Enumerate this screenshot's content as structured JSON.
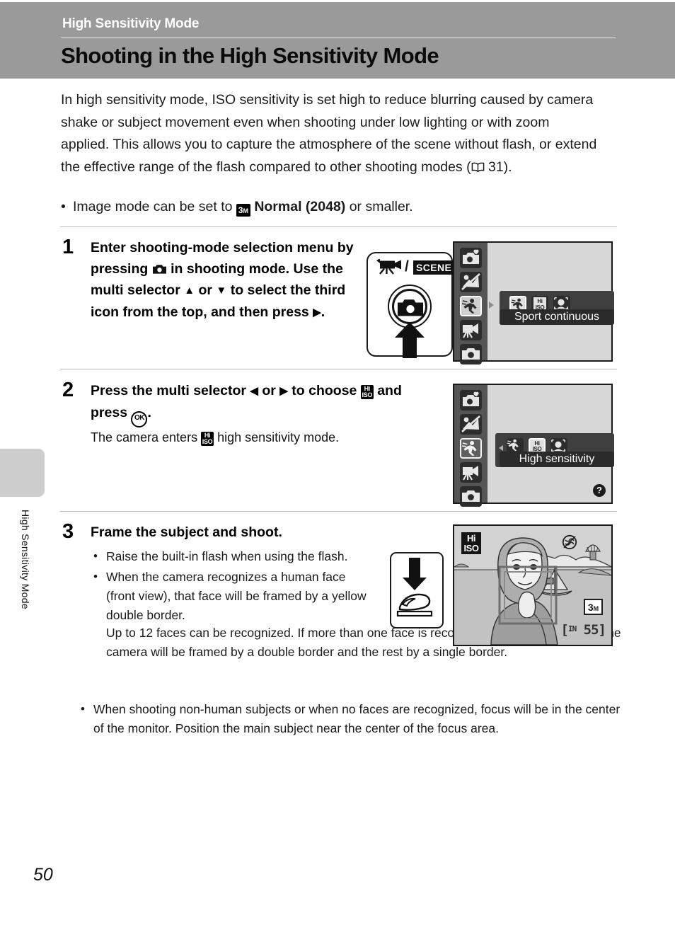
{
  "header": {
    "section_label": "High Sensitivity Mode",
    "title": "Shooting in the High Sensitivity Mode"
  },
  "side_tab": {
    "label": "High Sensitivity Mode"
  },
  "intro": {
    "paragraph_part1": "In high sensitivity mode, ISO sensitivity is set high to reduce blurring caused by camera shake or subject movement even when shooting under low lighting or with zoom applied. This allows you to capture the atmosphere of the scene without flash, or extend the effective range of the flash compared to other shooting modes (",
    "paragraph_part2": " 31).",
    "bullet_part1": "Image mode can be set to ",
    "bullet_bold": "Normal (2048)",
    "bullet_part2": " or smaller."
  },
  "steps": [
    {
      "number": "1",
      "text_part1": "Enter shooting-mode selection menu by pressing ",
      "text_part2": " in shooting mode. Use the multi selector ",
      "text_part3": " or ",
      "text_part4": " to select the third icon from the top, and then press ",
      "text_part5": "."
    },
    {
      "number": "2",
      "text_part1": "Press the multi selector ",
      "text_part2": " or ",
      "text_part3": " to choose ",
      "text_part4": " and press ",
      "text_part5": ".",
      "note_part1": "The camera enters ",
      "note_part2": " high sensitivity mode."
    },
    {
      "number": "3",
      "heading": "Frame the subject and shoot.",
      "bullets": [
        "Raise the built-in flash when using the flash.",
        "When the camera recognizes a human face (front view), that face will be framed by a yellow double border.",
        "When shooting non-human subjects or when no faces are recognized, focus will be in the center of the monitor. Position the main subject near the center of the focus area."
      ],
      "plain_note": "Up to 12 faces can be recognized. If more than one face is recognized, the face nearest to the camera will be framed by a double border and the rest by a single border."
    }
  ],
  "figure_step1": {
    "scene_label": "SCENE",
    "slash": "/",
    "movie_icon": "movie-camera-icon",
    "shooting_mode_icon": "camera-icon",
    "arrow_icon": "up-arrow-icon"
  },
  "lcd_step1": {
    "sidebar_icons": [
      "auto-scene-icon",
      "portrait-landscape-icon",
      "sport-running-icon",
      "movie-icon",
      "shooting-mode-icon"
    ],
    "selected_index": 2,
    "popup_icons": [
      "sport-running-icon",
      "high-sensitivity-icon",
      "smile-portrait-icon"
    ],
    "popup_selected_index": 0,
    "label": "Sport continuous"
  },
  "lcd_step2": {
    "sidebar_icons": [
      "auto-scene-icon",
      "portrait-landscape-icon",
      "sport-running-icon",
      "movie-icon",
      "shooting-mode-icon"
    ],
    "selected_index": 2,
    "popup_icons": [
      "sport-running-icon",
      "high-sensitivity-icon",
      "smile-portrait-icon"
    ],
    "popup_selected_index": 1,
    "label": "High sensitivity",
    "help_badge": "?",
    "left_caret": "left-caret-icon"
  },
  "figure_step3": {
    "press_icon": "shutter-press-finger-icon",
    "down_arrow_icon": "down-arrow-icon"
  },
  "photo_step3": {
    "mode_badge_line1": "Hi",
    "mode_badge_line2": "ISO",
    "image_mode_number": "3",
    "image_mode_unit": "M",
    "shots_remaining": "[ᴵᴺ 55]",
    "shots_text": "55",
    "memory_label": "IN",
    "vibration_icon": "vibration-reduction-icon",
    "scene_contents": "woman-portrait-with-lake-and-sailboat"
  },
  "page": {
    "number": "50"
  },
  "colors": {
    "header_bg": "#9a9a9a",
    "side_tab_bg": "#cdcdcd",
    "lcd_bg": "#d7d7d7",
    "lcd_sidebar": "#555555",
    "popup_bg": "#3f3f3f",
    "label_bar_bg": "#2b2b2b",
    "text": "#1b1b1b"
  }
}
